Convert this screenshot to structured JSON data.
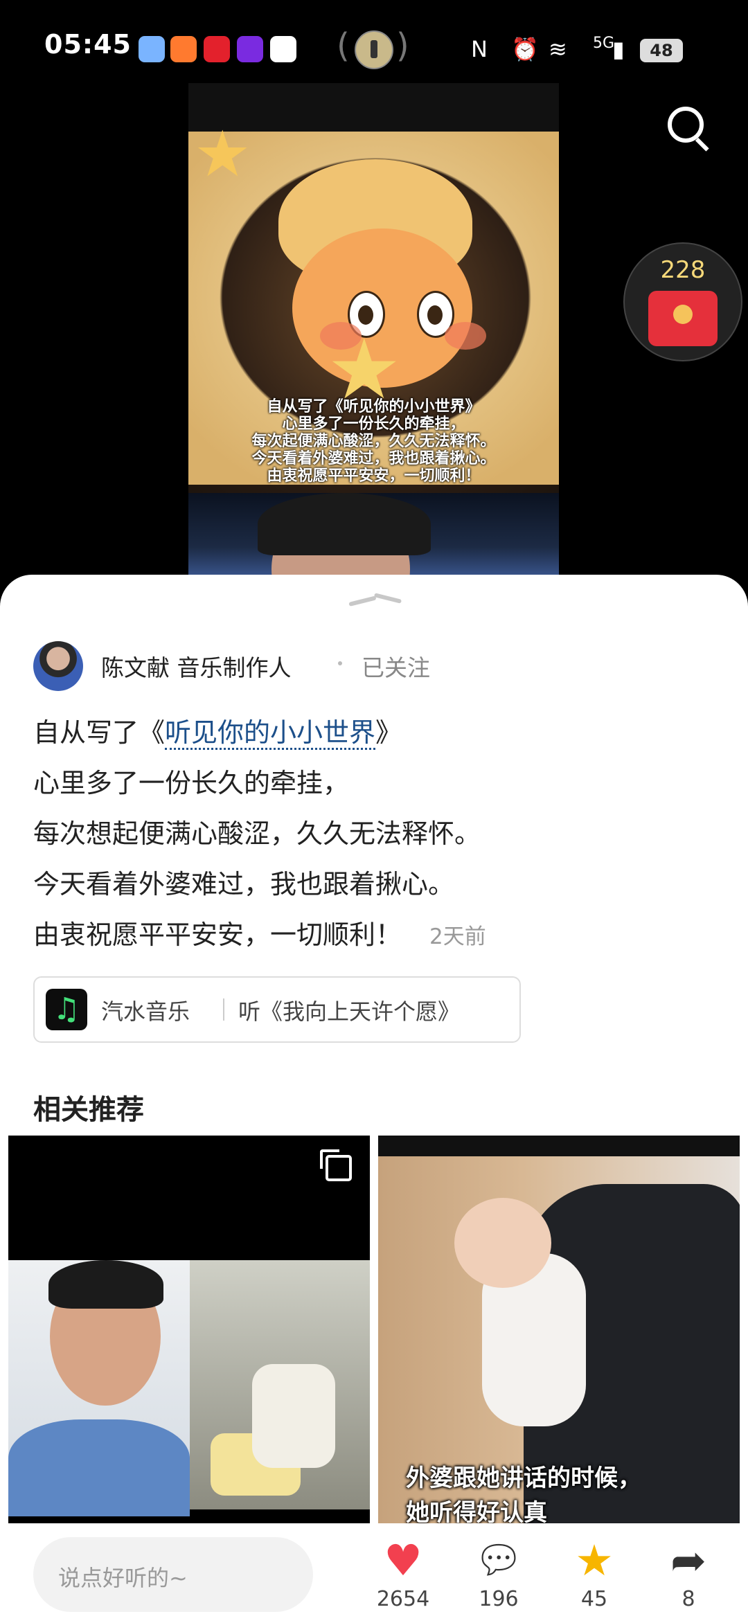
{
  "status_bar": {
    "time": "05:45",
    "battery": "48",
    "network": "5G",
    "icons": [
      "weather-icon",
      "app-icon",
      "xiaohongshu-icon",
      "calendar-icon",
      "umbrella-icon",
      "flashlight-icon",
      "nfc-icon",
      "alarm-icon",
      "wifi-icon",
      "signal-icon",
      "battery-icon"
    ]
  },
  "video": {
    "caption_lines": [
      "自从写了《听见你的小小世界》",
      "心里多了一份长久的牵挂，",
      "每次起便满心酸涩，久久无法释怀。",
      "今天看着外婆难过，我也跟着揪心。",
      "由衷祝愿平平安安，一切顺利！"
    ]
  },
  "red_packet": {
    "count": "228"
  },
  "post": {
    "author": "陈文献 音乐制作人",
    "follow_status": "已关注",
    "text_prefix": "自从写了《",
    "song_link": "听见你的小小世界",
    "text_suffix": "》",
    "lines": [
      "心里多了一份长久的牵挂，",
      "每次想起便满心酸涩，久久无法释怀。",
      "今天看着外婆难过，我也跟着揪心。",
      "由衷祝愿平平安安，一切顺利！"
    ],
    "time_ago": "2天前"
  },
  "music_card": {
    "source": "汽水音乐",
    "title": "听《我向上天许个愿》"
  },
  "recommend": {
    "title": "相关推荐",
    "items": [
      {
        "caption": ""
      },
      {
        "caption_lines": [
          "外婆跟她讲话的时候，",
          "她听得好认真"
        ]
      }
    ]
  },
  "bottom_bar": {
    "comment_placeholder": "说点好听的~",
    "likes": "2654",
    "comments": "196",
    "favorites": "45",
    "shares": "8"
  },
  "colors": {
    "like": "#f2404f",
    "favorite": "#f7b500",
    "link": "#1c4f8a"
  }
}
